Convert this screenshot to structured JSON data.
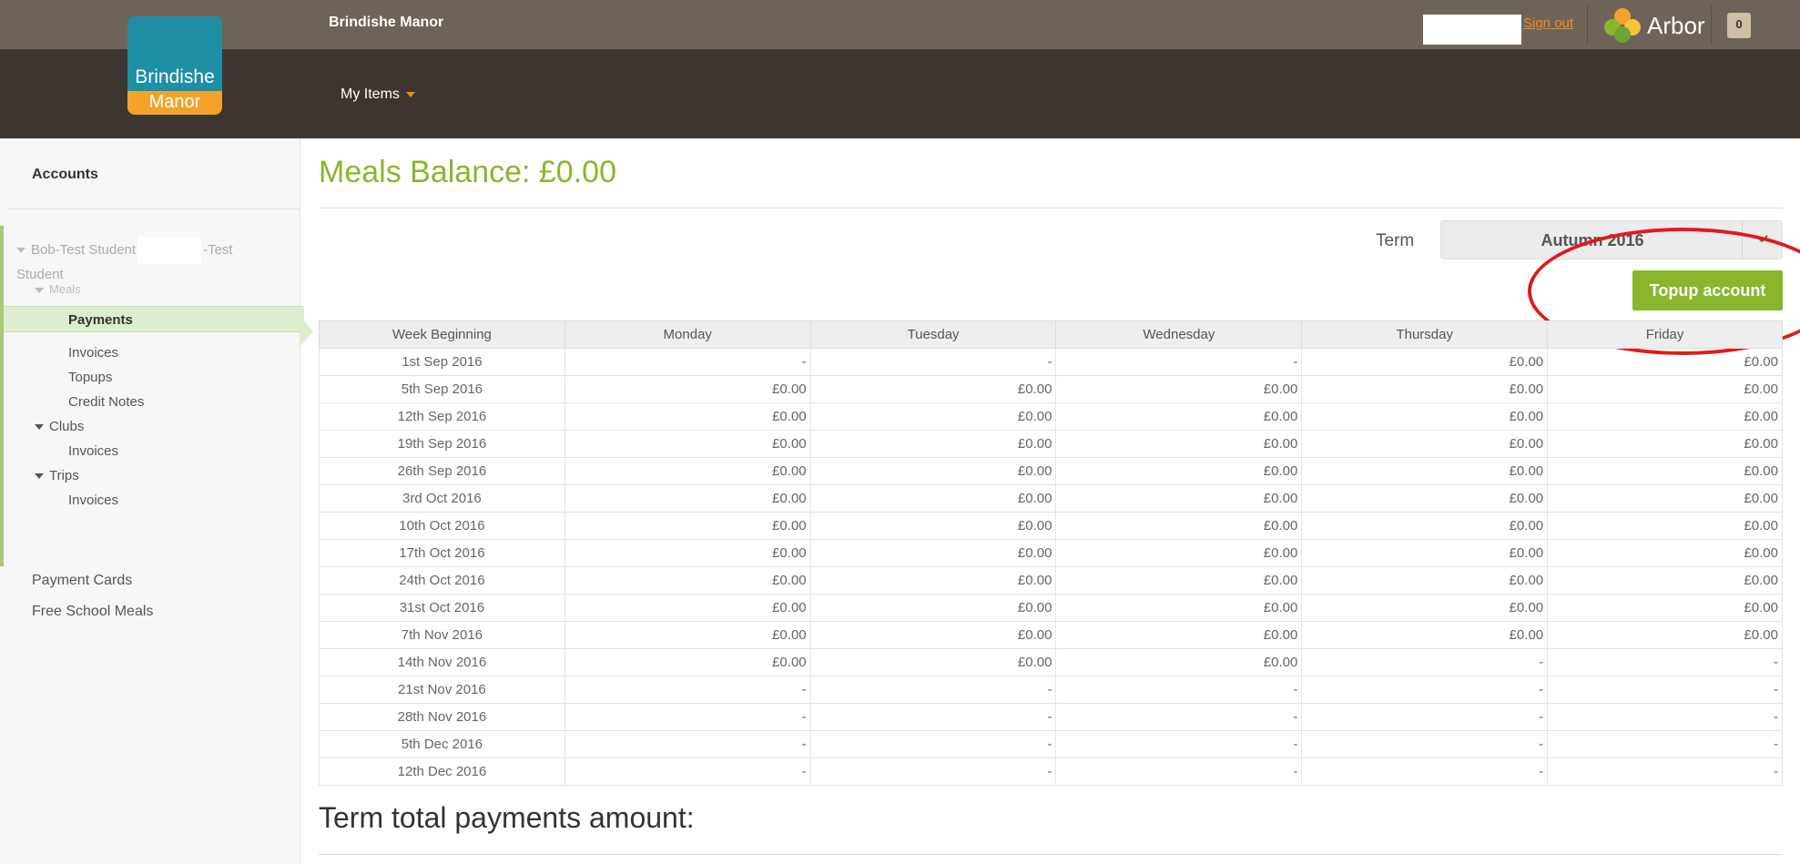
{
  "header": {
    "logo_line1": "Brindishe",
    "logo_line2": "Manor",
    "school_name": "Brindishe Manor",
    "menu_label": "My Items",
    "sign_out": "Sign out",
    "brand": "Arbor",
    "notification_count": "0",
    "colors": {
      "topbar": "#3d3530",
      "strip": "#6e6358",
      "accent": "#f08c1c"
    }
  },
  "sidebar": {
    "title": "Accounts",
    "student_first": "Bob-Test Student",
    "student_last": "-Test Student",
    "meals_label": "Meals",
    "meals_items": [
      "Payments",
      "Invoices",
      "Topups",
      "Credit Notes"
    ],
    "clubs_label": "Clubs",
    "clubs_items": [
      "Invoices"
    ],
    "trips_label": "Trips",
    "trips_items": [
      "Invoices"
    ],
    "links": [
      "Payment Cards",
      "Free School Meals"
    ]
  },
  "main": {
    "title": "Meals Balance: £0.00",
    "term_label": "Term",
    "term_value": "Autumn 2016",
    "topup_label": "Topup account",
    "total_label": "Term total payments amount:",
    "accent_color": "#8ab62c"
  },
  "table": {
    "columns": [
      "Week Beginning",
      "Monday",
      "Tuesday",
      "Wednesday",
      "Thursday",
      "Friday"
    ],
    "rows": [
      [
        "1st Sep 2016",
        "-",
        "-",
        "-",
        "£0.00",
        "£0.00"
      ],
      [
        "5th Sep 2016",
        "£0.00",
        "£0.00",
        "£0.00",
        "£0.00",
        "£0.00"
      ],
      [
        "12th Sep 2016",
        "£0.00",
        "£0.00",
        "£0.00",
        "£0.00",
        "£0.00"
      ],
      [
        "19th Sep 2016",
        "£0.00",
        "£0.00",
        "£0.00",
        "£0.00",
        "£0.00"
      ],
      [
        "26th Sep 2016",
        "£0.00",
        "£0.00",
        "£0.00",
        "£0.00",
        "£0.00"
      ],
      [
        "3rd Oct 2016",
        "£0.00",
        "£0.00",
        "£0.00",
        "£0.00",
        "£0.00"
      ],
      [
        "10th Oct 2016",
        "£0.00",
        "£0.00",
        "£0.00",
        "£0.00",
        "£0.00"
      ],
      [
        "17th Oct 2016",
        "£0.00",
        "£0.00",
        "£0.00",
        "£0.00",
        "£0.00"
      ],
      [
        "24th Oct 2016",
        "£0.00",
        "£0.00",
        "£0.00",
        "£0.00",
        "£0.00"
      ],
      [
        "31st Oct 2016",
        "£0.00",
        "£0.00",
        "£0.00",
        "£0.00",
        "£0.00"
      ],
      [
        "7th Nov 2016",
        "£0.00",
        "£0.00",
        "£0.00",
        "£0.00",
        "£0.00"
      ],
      [
        "14th Nov 2016",
        "£0.00",
        "£0.00",
        "£0.00",
        "-",
        "-"
      ],
      [
        "21st Nov 2016",
        "-",
        "-",
        "-",
        "-",
        "-"
      ],
      [
        "28th Nov 2016",
        "-",
        "-",
        "-",
        "-",
        "-"
      ],
      [
        "5th Dec 2016",
        "-",
        "-",
        "-",
        "-",
        "-"
      ],
      [
        "12th Dec 2016",
        "-",
        "-",
        "-",
        "-",
        "-"
      ]
    ]
  }
}
